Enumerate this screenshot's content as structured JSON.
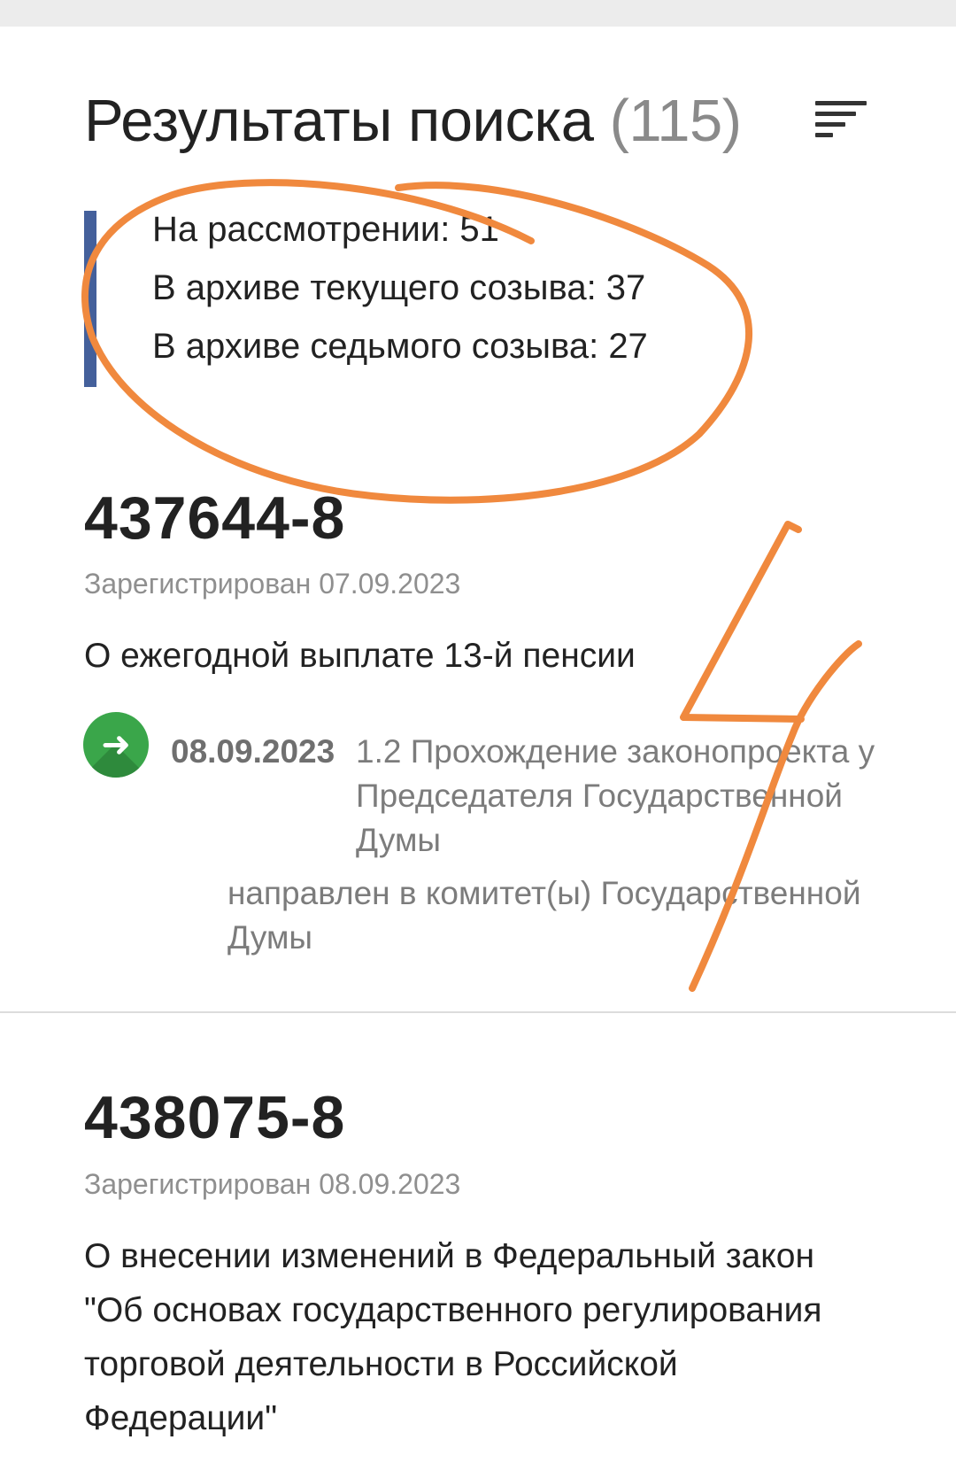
{
  "header": {
    "title": "Результаты поиска",
    "count": "(115)",
    "sort_icon": "sort-lines-icon"
  },
  "summary": {
    "on_review": "На рассмотрении: 51",
    "archive_current": "В архиве текущего созыва: 37",
    "archive_seventh": "В архиве седьмого созыва: 27"
  },
  "results": [
    {
      "number": "437644-8",
      "registered": "Зарегистрирован 07.09.2023",
      "title": "О ежегодной выплате 13-й пенсии",
      "event": {
        "icon": "green-arrow-icon",
        "date": "08.09.2023",
        "stage": "1.2 Прохождение законопроекта у Председателя Государственной Думы",
        "decision": "направлен в комитет(ы) Государственной Думы"
      }
    },
    {
      "number": "438075-8",
      "registered": "Зарегистрирован 08.09.2023",
      "title": "О внесении изменений в Федеральный закон \"Об основах государственного регулирования торговой деятельности в Российской Федерации\""
    }
  ],
  "annotation": {
    "handwritten_digit": "4",
    "color": "#f0893e"
  },
  "colors": {
    "accent_bar": "#44609b",
    "event_icon": "#3aa64a",
    "muted_text": "#8f8f8f"
  }
}
